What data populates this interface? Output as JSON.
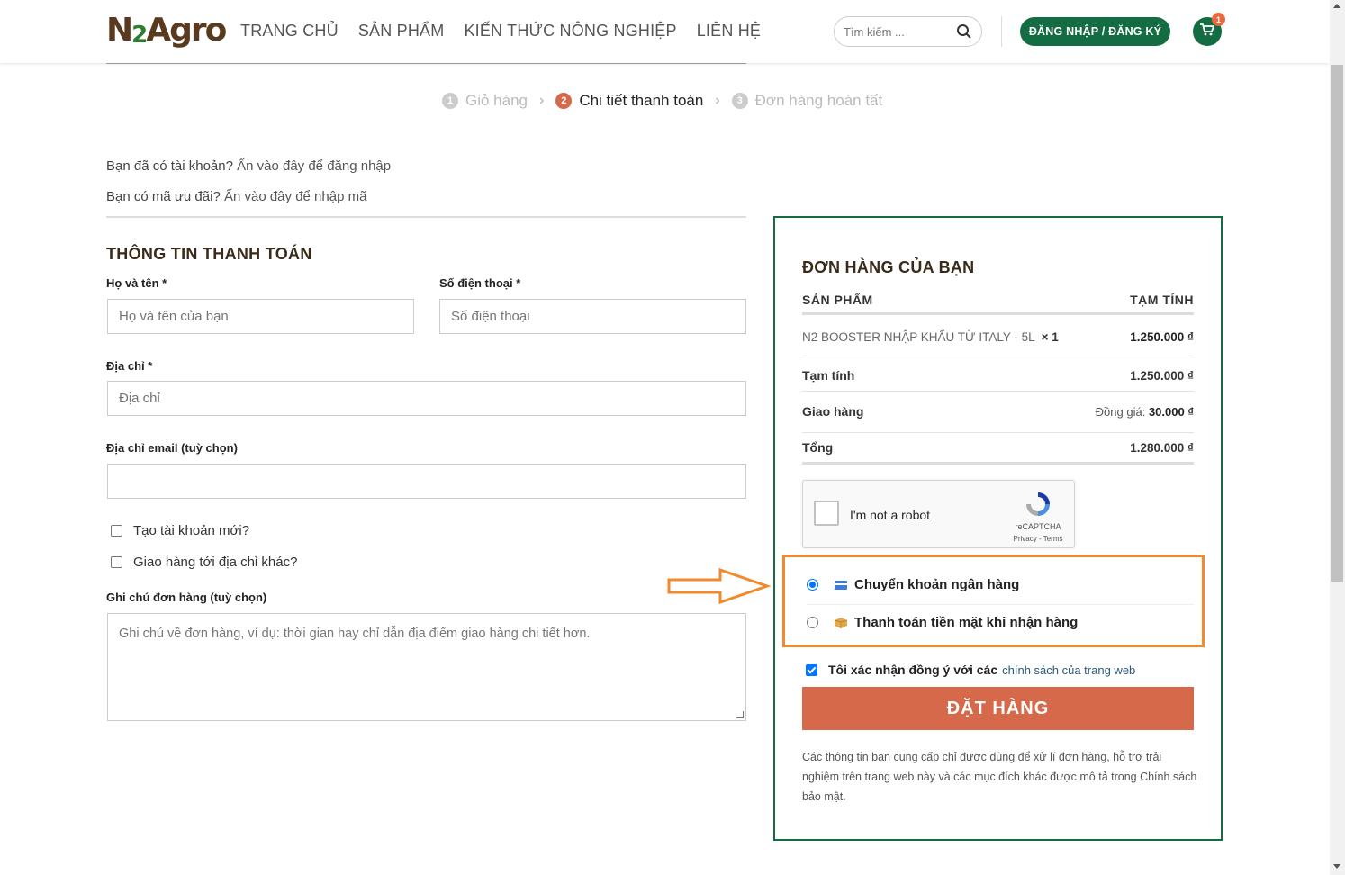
{
  "header": {
    "logo": {
      "n": "N",
      "two": "2",
      "agro": "Agro"
    },
    "nav": [
      "TRANG CHỦ",
      "SẢN PHẨM",
      "KIẾN THỨC NÔNG NGHIỆP",
      "LIÊN HỆ"
    ],
    "search_placeholder": "Tìm kiếm ...",
    "login_label": "ĐĂNG NHẬP / ĐĂNG KÝ",
    "cart_count": "1"
  },
  "steps": [
    {
      "num": "1",
      "label": "Giỏ hàng"
    },
    {
      "num": "2",
      "label": "Chi tiết thanh toán"
    },
    {
      "num": "3",
      "label": "Đơn hàng hoàn tất"
    }
  ],
  "notices": {
    "login_text": "Bạn đã có tài khoản?",
    "login_link": "Ấn vào đây để đăng nhập",
    "coupon_text": "Bạn có mã ưu đãi?",
    "coupon_link": "Ấn vào đây để nhập mã"
  },
  "billing": {
    "title": "THÔNG TIN THANH TOÁN",
    "name_label": "Họ và tên *",
    "name_placeholder": "Họ và tên của bạn",
    "phone_label": "Số điện thoại *",
    "phone_placeholder": "Số điện thoại",
    "address_label": "Địa chỉ *",
    "address_placeholder": "Địa chỉ",
    "email_label": "Địa chỉ email (tuỳ chọn)",
    "create_account": "Tạo tài khoản mới?",
    "ship_different": "Giao hàng tới địa chỉ khác?",
    "notes_label": "Ghi chú đơn hàng (tuỳ chọn)",
    "notes_placeholder": "Ghi chú về đơn hàng, ví dụ: thời gian hay chỉ dẫn địa điểm giao hàng chi tiết hơn."
  },
  "order": {
    "title": "ĐƠN HÀNG CỦA BẠN",
    "col_product": "SẢN PHẨM",
    "col_subtotal": "TẠM TÍNH",
    "item_name": "N2 BOOSTER NHẬP KHẨU TỪ ITALY - 5L",
    "item_qty": "× 1",
    "item_price": "1.250.000 ₫",
    "subtotal_label": "Tạm tính",
    "subtotal_value": "1.250.000 ₫",
    "shipping_label": "Giao hàng",
    "shipping_prefix": "Đồng giá:",
    "shipping_value": "30.000 ₫",
    "total_label": "Tổng",
    "total_value": "1.280.000 ₫"
  },
  "captcha": {
    "text": "I'm not a robot",
    "brand": "reCAPTCHA",
    "terms": "Privacy - Terms"
  },
  "payment": {
    "bank": "Chuyển khoản ngân hàng",
    "cod": "Thanh toán tiền mặt khi nhận hàng"
  },
  "agree": {
    "text": "Tôi xác nhận đồng ý với các",
    "link": "chính sách của trang web"
  },
  "place_order": "ĐẶT HÀNG",
  "privacy_text": "Các thông tin bạn cung cấp chỉ được dùng để xử lí đơn hàng, hỗ trợ trải nghiệm trên trang web này và các mục đích khác được mô tả trong Chính sách bảo mật.",
  "colors": {
    "brand_green": "#146c43",
    "accent_orange": "#d5694a",
    "highlight": "#f08a2c"
  }
}
